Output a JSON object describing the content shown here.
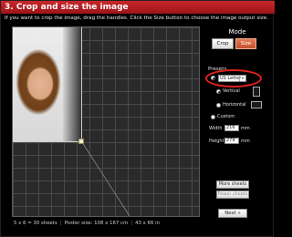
{
  "header": {
    "title": "3. Crop and size the image",
    "instructions": "If you want to crop the image, drag the handles. Click the Size button to choose the image output size."
  },
  "mode": {
    "label": "Mode",
    "crop_label": "Crop",
    "size_label": "Size",
    "active": "Size"
  },
  "presets": {
    "label": "Presets",
    "selected": "US Letter",
    "orientation": {
      "vertical_label": "Vertical",
      "horizontal_label": "Horizontal",
      "selected": "Vertical"
    },
    "custom_label": "Custom",
    "width_label": "Width",
    "width_value": "216",
    "height_label": "Height",
    "height_value": "279",
    "unit": "mm"
  },
  "buttons": {
    "more_sheets": "More sheets",
    "fewer_sheets": "Fewer sheets",
    "next": "Next »"
  },
  "footer": {
    "sheets": "5 x 6 = 30 sheets",
    "poster_size": "Poster size: 108 x 167 cm",
    "inches": "43 x 66 in"
  },
  "colors": {
    "title_bar": "#b81e22",
    "active_button": "#d4633d",
    "highlight_ring": "#e2201d"
  }
}
